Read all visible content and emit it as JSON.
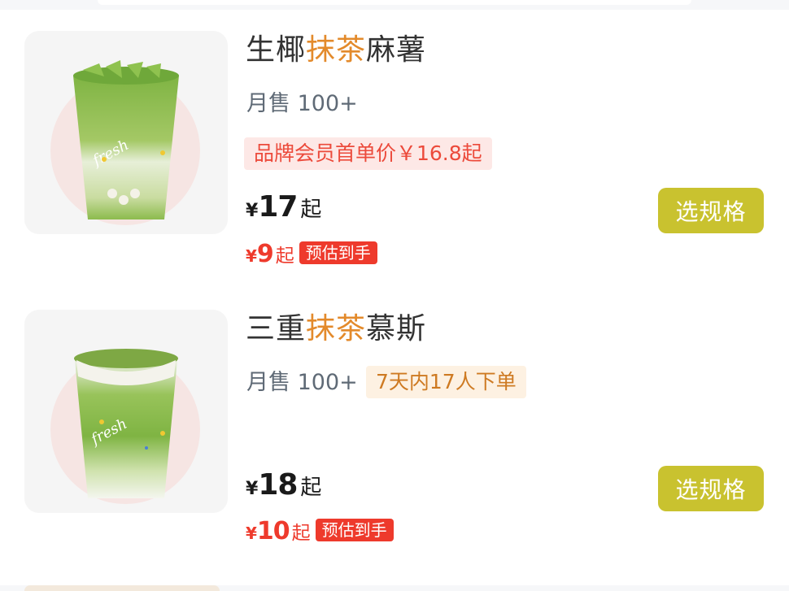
{
  "products": [
    {
      "title_prefix": "生椰",
      "title_highlight": "抹茶",
      "title_suffix": "麻薯",
      "sales": "月售 100+",
      "promo": "品牌会员首单价￥16.8起",
      "price_symbol": "¥",
      "price": "17",
      "price_unit": "起",
      "est_symbol": "¥",
      "est_price": "9",
      "est_unit": "起",
      "est_badge": "预估到手",
      "button": "选规格"
    },
    {
      "title_prefix": "三重",
      "title_highlight": "抹茶",
      "title_suffix": "慕斯",
      "sales": "月售 100+",
      "orders_tag": "7天内17人下单",
      "price_symbol": "¥",
      "price": "18",
      "price_unit": "起",
      "est_symbol": "¥",
      "est_price": "10",
      "est_unit": "起",
      "est_badge": "预估到手",
      "button": "选规格"
    }
  ],
  "colors": {
    "highlight": "#e38a2b",
    "promo_text": "#ec4a3b",
    "estimate": "#ee3a2c",
    "button_bg": "#c9c22f"
  }
}
